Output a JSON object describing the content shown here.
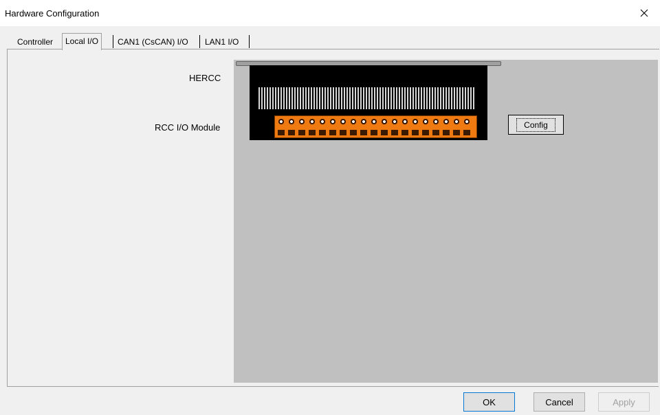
{
  "window": {
    "title": "Hardware Configuration"
  },
  "tabs": [
    {
      "label": "Controller",
      "active": false
    },
    {
      "label": "Local I/O",
      "active": true
    },
    {
      "label": "CAN1 (CsCAN) I/O",
      "active": false
    },
    {
      "label": "LAN1 I/O",
      "active": false
    }
  ],
  "local_io": {
    "device_label": "HERCC",
    "module_label": "RCC I/O Module",
    "config_button": "Config"
  },
  "footer": {
    "ok": "OK",
    "cancel": "Cancel",
    "apply": "Apply"
  },
  "colors": {
    "terminal_block": "#f07a12",
    "device_body": "#000000",
    "workspace": "#c0c0c0"
  },
  "icons": {
    "close": "close-icon"
  }
}
